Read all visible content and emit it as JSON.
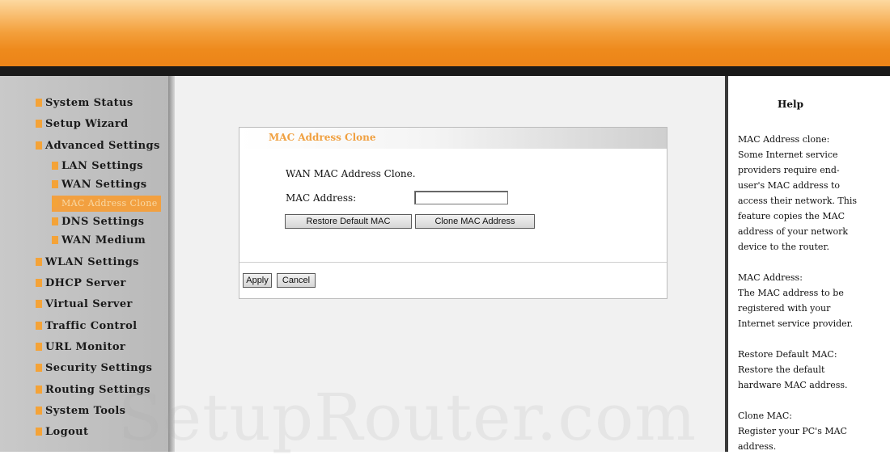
{
  "sidebar": {
    "items": [
      {
        "label": "System Status"
      },
      {
        "label": "Setup Wizard"
      },
      {
        "label": "Advanced Settings"
      },
      {
        "label": "LAN Settings"
      },
      {
        "label": "WAN Settings"
      },
      {
        "label": "MAC Address Clone"
      },
      {
        "label": "DNS Settings"
      },
      {
        "label": "WAN Medium"
      },
      {
        "label": "WLAN Settings"
      },
      {
        "label": "DHCP Server"
      },
      {
        "label": "Virtual Server"
      },
      {
        "label": "Traffic Control"
      },
      {
        "label": "URL Monitor"
      },
      {
        "label": "Security Settings"
      },
      {
        "label": "Routing Settings"
      },
      {
        "label": "System Tools"
      },
      {
        "label": "Logout"
      }
    ]
  },
  "panel": {
    "title": "MAC Address Clone",
    "intro": "WAN MAC Address Clone.",
    "mac_label": "MAC Address:",
    "mac_value": "",
    "restore_button": "Restore Default MAC",
    "clone_button": "Clone MAC Address",
    "apply_button": "Apply",
    "cancel_button": "Cancel"
  },
  "help": {
    "title": "Help",
    "blocks": [
      {
        "lines": [
          "MAC Address clone:",
          "Some Internet service providers require end-user's MAC address to access their network. This feature copies the MAC address of your network device to the router."
        ]
      },
      {
        "lines": [
          "MAC Address:",
          "The MAC address to be registered with your Internet service provider."
        ]
      },
      {
        "lines": [
          "Restore Default MAC:",
          "Restore the default hardware MAC address."
        ]
      },
      {
        "lines": [
          "Clone MAC:",
          "Register your PC's MAC address."
        ]
      }
    ]
  },
  "watermark": "SetupRouter.com",
  "colors": {
    "accent": "#ee8a1c",
    "highlight": "#f2a040",
    "title": "#f0a040"
  }
}
